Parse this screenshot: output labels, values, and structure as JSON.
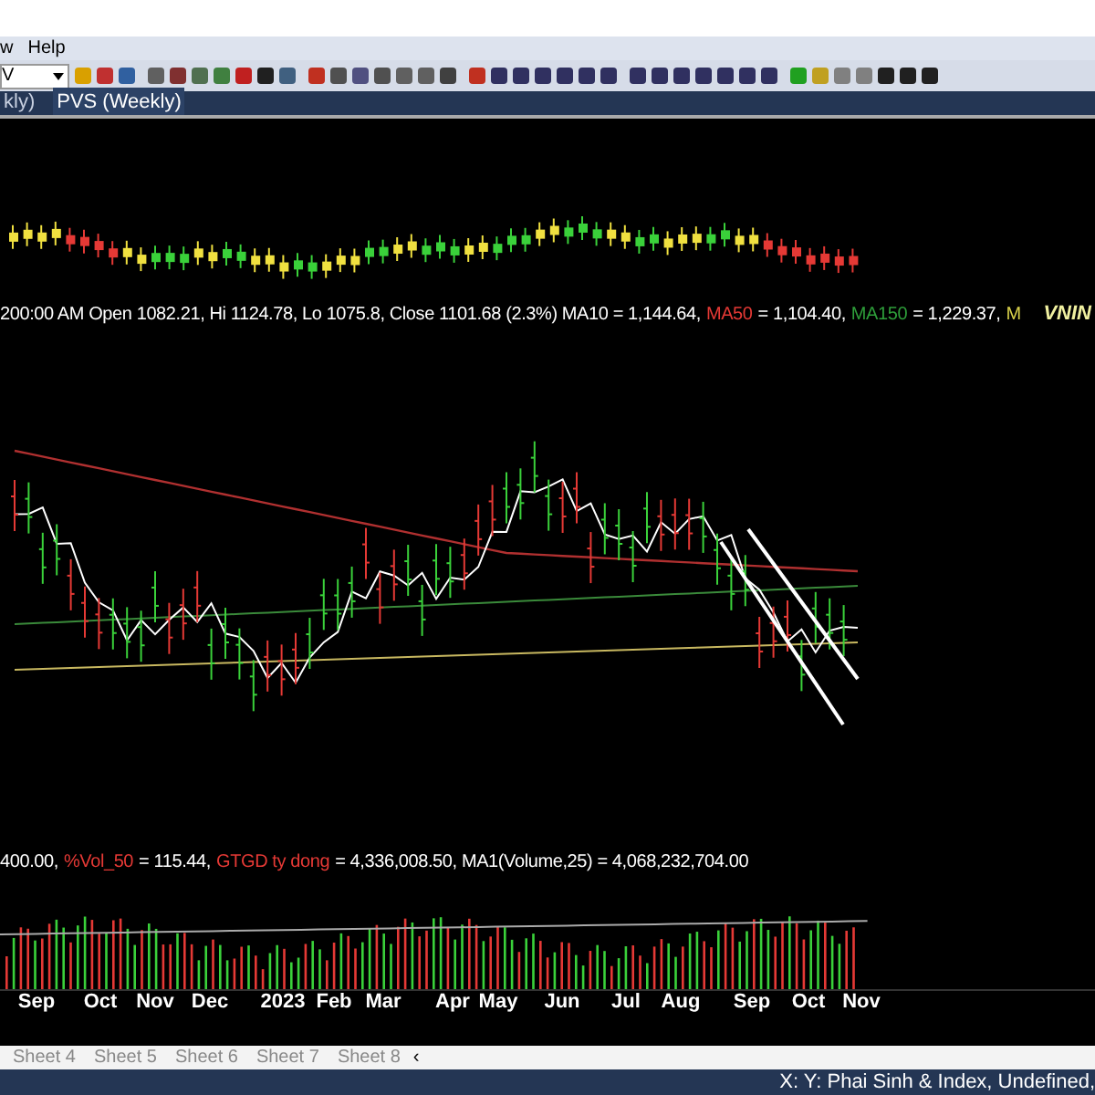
{
  "menu": [
    {
      "label": "w"
    },
    {
      "label": "Help"
    }
  ],
  "toolbar": {
    "symbol_field": {
      "value": "V"
    }
  },
  "chart_tabs": [
    {
      "label": "kly)",
      "selected": false
    },
    {
      "label": "PVS (Weekly)",
      "selected": true
    }
  ],
  "price_info": [
    {
      "text": "200:00 AM Open 1082.21, Hi 1124.78, Lo 1075.8, Close 1101.68 (2.3%) MA10 = 1,144.64,",
      "color": "#ffffff"
    },
    {
      "text": "MA50",
      "color": "#e53935"
    },
    {
      "text": "= 1,104.40,",
      "color": "#ffffff"
    },
    {
      "text": "MA150",
      "color": "#2e9e3a"
    },
    {
      "text": "= 1,229.37,",
      "color": "#ffffff"
    },
    {
      "text": "M",
      "color": "#d8d04a"
    }
  ],
  "watermark_symbol": "VNIN",
  "volume_info": [
    {
      "text": "400.00,",
      "color": "#ffffff"
    },
    {
      "text": "%Vol_50",
      "color": "#e53935"
    },
    {
      "text": "= 115.44,",
      "color": "#ffffff"
    },
    {
      "text": "GTGD ty dong",
      "color": "#e53935"
    },
    {
      "text": "= 4,336,008.50, MA1(Volume,25) = 4,068,232,704.00",
      "color": "#ffffff"
    }
  ],
  "x_axis": [
    "Sep",
    "Oct",
    "Nov",
    "Dec",
    "2023",
    "Feb",
    "Mar",
    "Apr",
    "May",
    "Jun",
    "Jul",
    "Aug",
    "Sep",
    "Oct",
    "Nov"
  ],
  "sheet_tabs": [
    {
      "label": "Sheet 4",
      "selected": false
    },
    {
      "label": "Sheet 5",
      "selected": false
    },
    {
      "label": "Sheet 6",
      "selected": false
    },
    {
      "label": "Sheet 7",
      "selected": false
    },
    {
      "label": "Sheet 8",
      "selected": false
    }
  ],
  "sheet_nav": "‹",
  "status_bar": {
    "text": "X: Y: Phai Sinh & Index, Undefined,"
  }
}
